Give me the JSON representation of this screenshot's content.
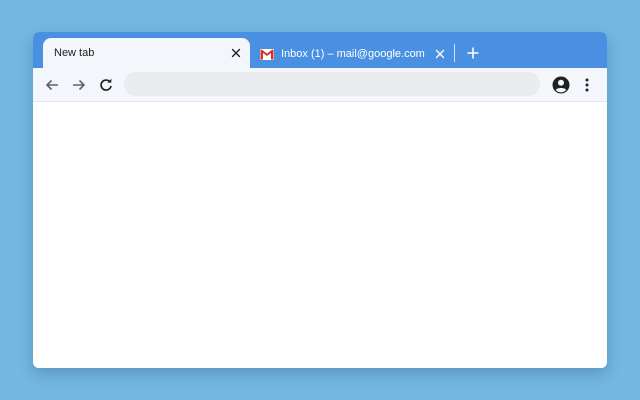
{
  "tabs": [
    {
      "title": "New tab",
      "active": true
    },
    {
      "title": "Inbox (1) – mail@google.com",
      "active": false,
      "favicon": "gmail-icon"
    }
  ],
  "toolbar": {
    "back_icon": "back-arrow-icon",
    "forward_icon": "forward-arrow-icon",
    "reload_icon": "reload-icon",
    "address_value": "",
    "profile_icon": "account-circle-icon",
    "menu_icon": "more-vert-icon"
  },
  "colors": {
    "desktop": "#74b8e1",
    "tabstrip": "#4a90e2",
    "toolbar": "#f3f6fb",
    "omnibox": "#e9ecef"
  }
}
